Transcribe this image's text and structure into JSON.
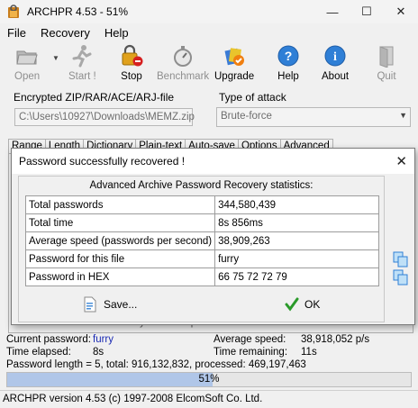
{
  "window": {
    "title": "ARCHPR 4.53 - 51%",
    "minimize": "—",
    "maximize": "☐",
    "close": "✕"
  },
  "menu": [
    "File",
    "Recovery",
    "Help"
  ],
  "toolbar": {
    "open": "Open",
    "start": "Start !",
    "stop": "Stop",
    "benchmark": "Benchmark",
    "upgrade": "Upgrade",
    "help": "Help",
    "about": "About",
    "quit": "Quit"
  },
  "encrypted_file": {
    "label": "Encrypted ZIP/RAR/ACE/ARJ-file",
    "value": "C:\\Users\\10927\\Downloads\\MEMZ.zip"
  },
  "attack": {
    "label": "Type of attack",
    "value": "Brute-force"
  },
  "tabs": [
    "Range",
    "Length",
    "Dictionary",
    "Plain-text",
    "Auto-save",
    "Options",
    "Advanced"
  ],
  "background_log": "2023/1/22 10:29:16 - 'furry' is a valid password for this file",
  "dialog": {
    "title": "Password successfully recovered !",
    "heading": "Advanced Archive Password Recovery statistics:",
    "rows": [
      {
        "key": "Total passwords",
        "value": "344,580,439"
      },
      {
        "key": "Total time",
        "value": "8s 856ms"
      },
      {
        "key": "Average speed (passwords per second)",
        "value": "38,909,263"
      },
      {
        "key": "Password for this file",
        "value": "furry"
      },
      {
        "key": "Password in HEX",
        "value": "66 75 72 72 79"
      }
    ],
    "save": "Save...",
    "ok": "OK"
  },
  "progress": {
    "current_password_label": "Current password:",
    "current_password": "furry",
    "average_speed_label": "Average speed:",
    "average_speed": "38,918,052 p/s",
    "time_elapsed_label": "Time elapsed:",
    "time_elapsed": "8s",
    "time_remaining_label": "Time remaining:",
    "time_remaining": "11s",
    "summary": "Password length = 5, total: 916,132,832, processed: 469,197,463",
    "percent_text": "51%",
    "fraction": 0.51
  },
  "statusbar": "ARCHPR version 4.53 (c) 1997-2008 ElcomSoft Co. Ltd."
}
